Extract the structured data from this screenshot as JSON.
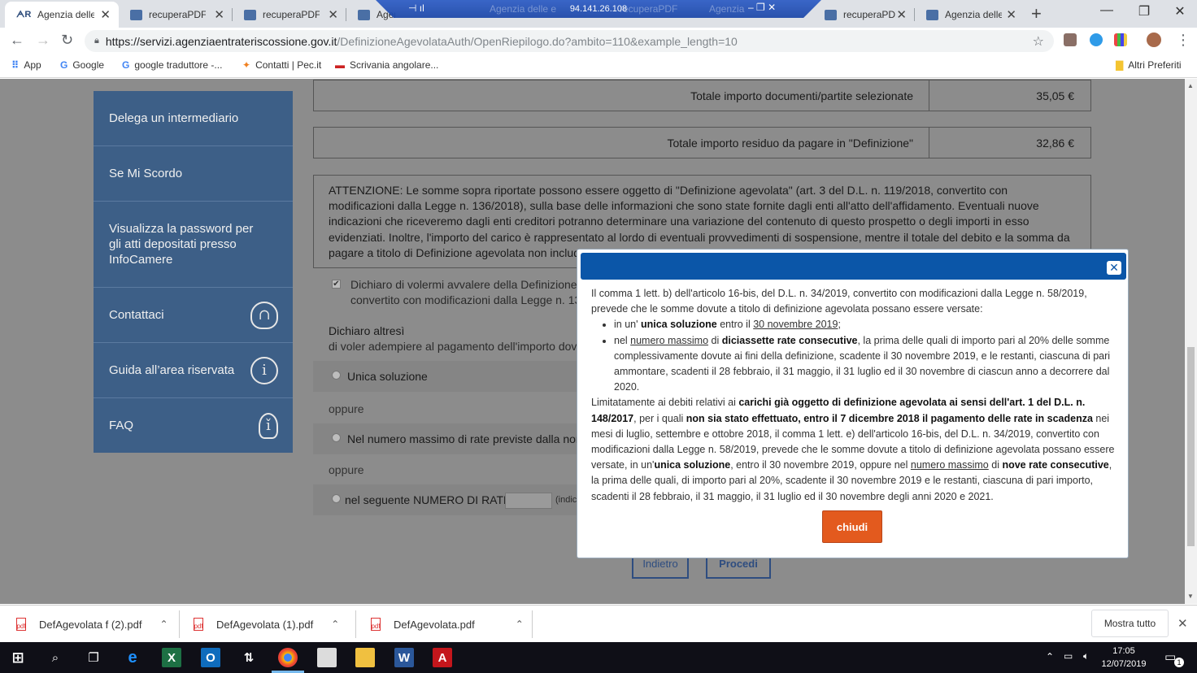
{
  "browser": {
    "tabs": [
      {
        "title": "Agenzia delle e",
        "active": true
      },
      {
        "title": "recuperaPDF"
      },
      {
        "title": "recuperaPDF"
      },
      {
        "title": "Agen"
      },
      {
        "title": "Agenzia delle e"
      },
      {
        "title": "recuperaPDF"
      },
      {
        "title": "Agenzia"
      },
      {
        "title": "recuperaPDF"
      },
      {
        "title": "Agenzia delle e"
      }
    ],
    "remote_ip": "94.141.26.108",
    "url_host": "https://servizi.agenziaentrateriscossione.gov.it",
    "url_path": "/DefinizioneAgevolataAuth/OpenRiepilogo.do?ambito=110&example_length=10",
    "bookmarks": [
      "App",
      "Google",
      "google traduttore -...",
      "Contatti | Pec.it",
      "Scrivania angolare..."
    ],
    "other_bookmarks": "Altri Preferiti"
  },
  "sidebar": {
    "items": [
      {
        "label": "Delega un intermediario"
      },
      {
        "label": "Se Mi Scordo"
      },
      {
        "label": "Visualizza la password per gli atti depositati presso InfoCamere"
      },
      {
        "label": "Contattaci",
        "icon": "headset-icon"
      },
      {
        "label": "Guida all’area riservata",
        "icon": "info-icon"
      },
      {
        "label": "FAQ",
        "icon": "lightbulb-icon"
      }
    ]
  },
  "totals": {
    "selected_label": "Totale importo documenti/partite selezionate",
    "selected_value": "35,05 €",
    "residual_label": "Totale importo residuo da pagare in \"Definizione\"",
    "residual_value": "32,86 €"
  },
  "attention_text": "ATTENZIONE: Le somme sopra riportate possono essere oggetto di \"Definizione agevolata\" (art. 3 del D.L. n. 119/2018, convertito con modificazioni dalla Legge n. 136/2018), sulla base delle informazioni che sono state fornite dagli enti all'atto dell'affidamento. Eventuali nuove indicazioni che riceveremo dagli enti creditori potranno determinare una variazione del contenuto di questo prospetto o degli importi in esso evidenziati. Inoltre, l'importo del carico è rappresentato al lordo di eventuali provvedimenti di sospensione, mentre il totale del debito e la somma da pagare a titolo di Definizione agevolata non includono eventuali diri",
  "form": {
    "declare_line1": "Dichiaro di volermi avvalere della Definizione",
    "declare_line2": "convertito con modificazioni dalla Legge n. 13",
    "also_title": "Dichiaro altresì",
    "also_text": "di voler adempiere al pagamento dell'importo dov",
    "opt_single": "Unica soluzione",
    "oppure": "oppure",
    "opt_max": "Nel numero massimo di rate previste dalla nor",
    "opt_num": "nel seguente NUMERO DI RATE",
    "opt_num_hint": "(indic",
    "back_label": "Indietro",
    "proceed_label": "Procedi"
  },
  "modal": {
    "p1": "Il comma 1 lett. b) dell'articolo 16-bis, del D.L. n. 34/2019, convertito con modificazioni dalla Legge n. 58/2019, prevede che le somme dovute a titolo di definizione agevolata possano essere versate:",
    "b1_pre": "in un' ",
    "b1_bold": "unica soluzione",
    "b1_mid": " entro il ",
    "b1_u": "30 novembre 2019",
    "b1_end": ";",
    "b2_pre": "nel ",
    "b2_u": "numero massimo",
    "b2_mid": " di ",
    "b2_bold": "diciassette rate consecutive",
    "b2_end": ", la prima delle quali di importo pari al 20% delle somme complessivamente dovute ai fini della definizione, scadente il 30 novembre 2019, e le restanti, ciascuna di pari ammontare, scadenti il 28 febbraio, il 31 maggio, il 31 luglio ed il 30 novembre di ciascun anno a decorrere dal 2020.",
    "p2_a": "Limitatamente ai debiti relativi ai ",
    "p2_b": "carichi già oggetto di definizione agevolata ai sensi dell'art. 1 del D.L. n. 148/2017",
    "p2_c": ", per i quali ",
    "p2_d": "non sia stato effettuato, entro il 7 dicembre 2018 il pagamento delle rate in scadenza",
    "p2_e": " nei mesi di luglio, settembre e ottobre 2018, il comma 1 lett. e) dell'articolo 16-bis, del D.L. n. 34/2019, convertito con modificazioni dalla Legge n. 58/2019, prevede che le somme dovute a titolo di definizione agevolata possano essere versate, in un'",
    "p2_f": "unica soluzione",
    "p2_g": ", entro il 30 novembre 2019, oppure nel ",
    "p2_h": "numero massimo",
    "p2_i": " di ",
    "p2_j": "nove rate consecutive",
    "p2_k": ", la prima delle quali, di importo pari al 20%, scadente il 30 novembre 2019 e le restanti, ciascuna di pari importo, scadenti il 28 febbraio, il 31 maggio, il 31 luglio ed il 30 novembre degli anni 2020 e 2021.",
    "close_label": "chiudi"
  },
  "downloads": {
    "files": [
      "DefAgevolata f (2).pdf",
      "DefAgevolata (1).pdf",
      "DefAgevolata.pdf"
    ],
    "show_all": "Mostra tutto"
  },
  "taskbar": {
    "time": "17:05",
    "date": "12/07/2019",
    "notif_count": "1"
  },
  "colors": {
    "sidebar_bg": "#3d5f87",
    "modal_header": "#0b56a8",
    "close_button": "#e35a1e",
    "overlay": "#8c8c8c"
  }
}
